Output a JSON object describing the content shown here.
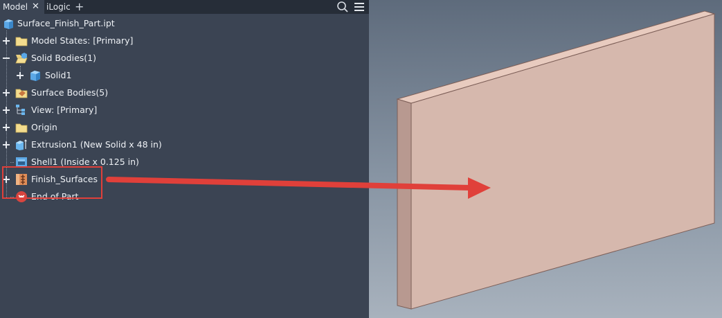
{
  "tabs": {
    "model": "Model",
    "close_glyph": "✕",
    "ilogic": "iLogic",
    "add_glyph": "+"
  },
  "toolbar": {
    "search_icon": "search-icon",
    "menu_icon": "hamburger-menu-icon"
  },
  "tree": {
    "root": "Surface_Finish_Part.ipt",
    "items": [
      {
        "label": "Model States: [Primary]",
        "icon": "folder-icon",
        "expander": "plus"
      },
      {
        "label": "Solid Bodies(1)",
        "icon": "folder-open-icon",
        "expander": "minus"
      },
      {
        "label": "Solid1",
        "icon": "solid-body-icon",
        "expander": "plus"
      },
      {
        "label": "Surface Bodies(5)",
        "icon": "surface-bodies-folder-icon",
        "expander": "plus"
      },
      {
        "label": "View: [Primary]",
        "icon": "view-rep-icon",
        "expander": "plus"
      },
      {
        "label": "Origin",
        "icon": "folder-icon",
        "expander": "plus"
      },
      {
        "label": "Extrusion1 (New Solid x 48 in)",
        "icon": "extrusion-icon",
        "expander": "plus"
      },
      {
        "label": "Shell1 (Inside x 0.125 in)",
        "icon": "shell-icon",
        "expander": "none"
      },
      {
        "label": "Finish_Surfaces",
        "icon": "finish-icon",
        "expander": "plus"
      },
      {
        "label": "End of Part",
        "icon": "end-of-part-icon",
        "expander": "none"
      }
    ]
  },
  "colors": {
    "panel_bg": "#3b4453",
    "tabbar_bg": "#262d38",
    "callout_red": "#e0403a",
    "part_face": "#d6b8ad",
    "part_top": "#e8cbbf",
    "part_side": "#b89990"
  }
}
